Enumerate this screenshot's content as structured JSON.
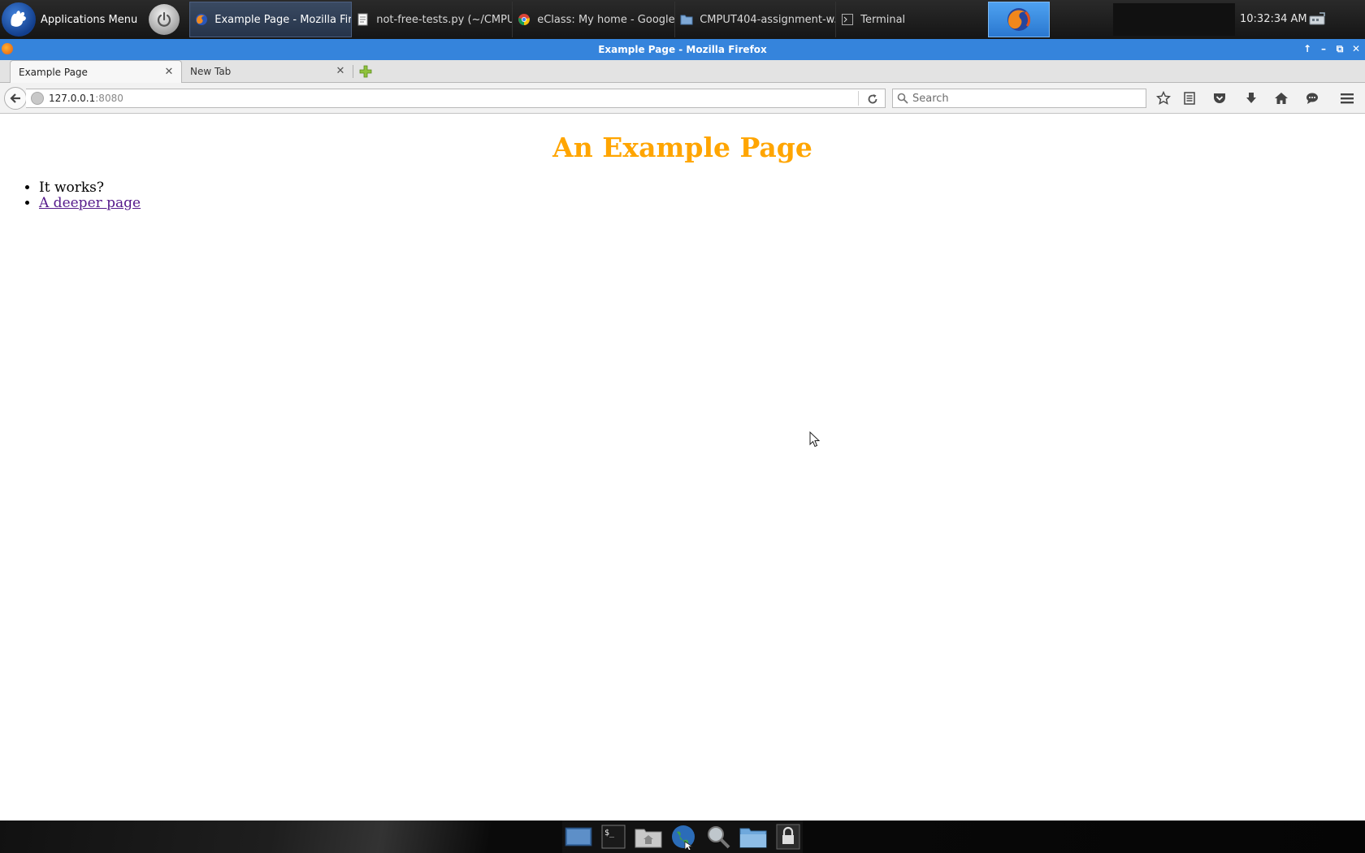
{
  "panel": {
    "apps_menu_label": "Applications Menu",
    "clock": "10:32:34 AM",
    "tasks": [
      {
        "label": "Example Page - Mozilla Fir...",
        "icon": "firefox-icon",
        "active": true
      },
      {
        "label": "not-free-tests.py (~/CMPU...",
        "icon": "text-editor-icon",
        "active": false
      },
      {
        "label": "eClass: My home - Google ...",
        "icon": "chrome-icon",
        "active": false
      },
      {
        "label": "CMPUT404-assignment-w...",
        "icon": "folder-icon",
        "active": false
      },
      {
        "label": "Terminal",
        "icon": "terminal-icon",
        "active": false
      }
    ]
  },
  "window": {
    "title": "Example Page - Mozilla Firefox",
    "buttons": [
      "pin-icon",
      "minimize-icon",
      "maximize-icon",
      "close-icon"
    ]
  },
  "browser": {
    "tabs": [
      {
        "label": "Example Page",
        "active": true
      },
      {
        "label": "New Tab",
        "active": false
      }
    ],
    "url_host": "127.0.0.1",
    "url_port": ":8080",
    "search_placeholder": "Search",
    "toolbar_icons": [
      "bookmark-star-icon",
      "reading-list-icon",
      "pocket-icon",
      "download-icon",
      "home-icon",
      "chat-icon",
      "hamburger-menu-icon"
    ]
  },
  "page": {
    "title": "An Example Page",
    "title_color": "#ffa500",
    "items": [
      {
        "text": "It works?",
        "link": false
      },
      {
        "text": "A deeper page",
        "link": true
      }
    ],
    "link_color": "#551a8b"
  },
  "dock": {
    "items": [
      "desktop-icon",
      "terminal-icon",
      "home-folder-icon",
      "web-browser-icon",
      "search-icon",
      "file-manager-icon",
      "lock-icon"
    ]
  },
  "colors": {
    "titlebar": "#3584dc",
    "panel": "#1d1d1d"
  }
}
